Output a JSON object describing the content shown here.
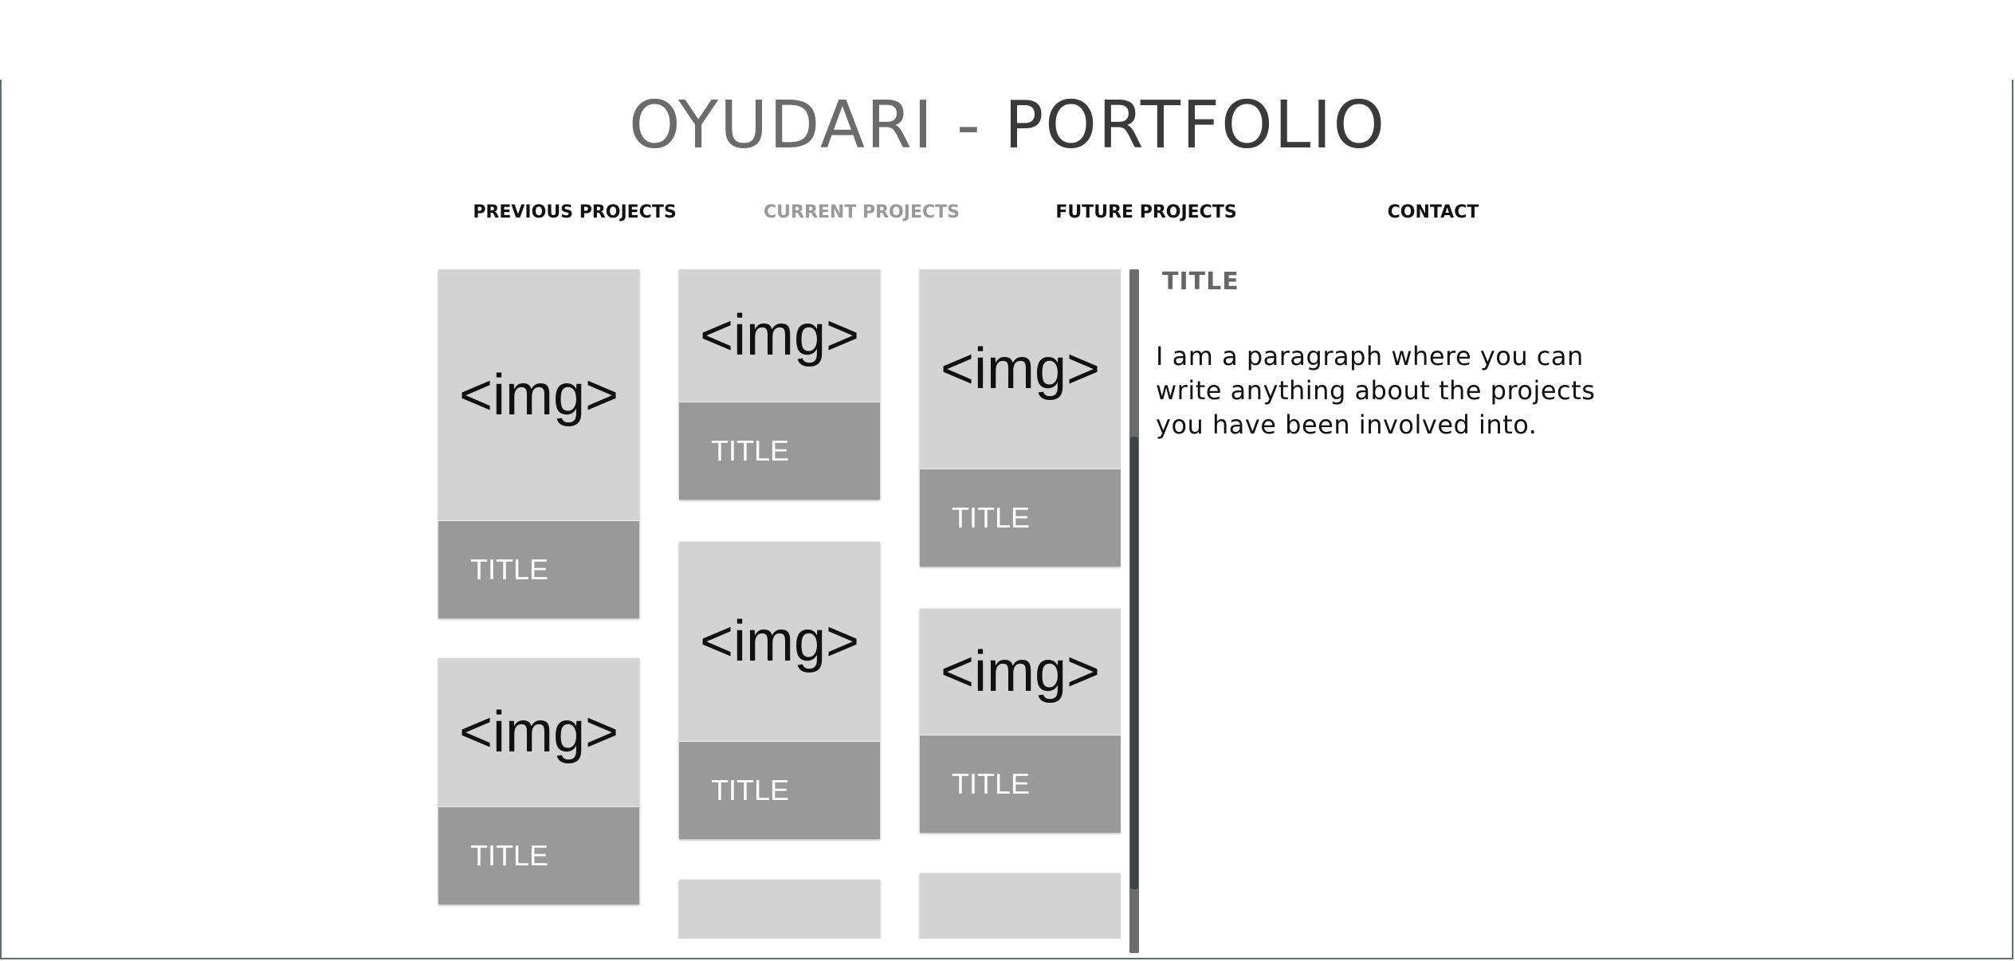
{
  "header": {
    "name": "OYUDARI",
    "separator": " - ",
    "label": "PORTFOLIO"
  },
  "nav": {
    "items": [
      {
        "label": "PREVIOUS PROJECTS"
      },
      {
        "label": "CURRENT PROJECTS"
      },
      {
        "label": "FUTURE PROJECTS"
      },
      {
        "label": "CONTACT"
      }
    ],
    "active_index": 1
  },
  "gallery": {
    "img_placeholder": "<img>",
    "cards": [
      {
        "title": "TITLE"
      },
      {
        "title": "TITLE"
      },
      {
        "title": "TITLE"
      },
      {
        "title": "TITLE"
      },
      {
        "title": "TITLE"
      },
      {
        "title": "TITLE"
      }
    ]
  },
  "detail": {
    "title": "TITLE",
    "paragraph": "I am a paragraph where you can write anything about the projects you have been involved into."
  },
  "colors": {
    "nav_active": "#999999",
    "card_image_bg": "#d3d3d3",
    "card_title_bg": "#999999"
  }
}
